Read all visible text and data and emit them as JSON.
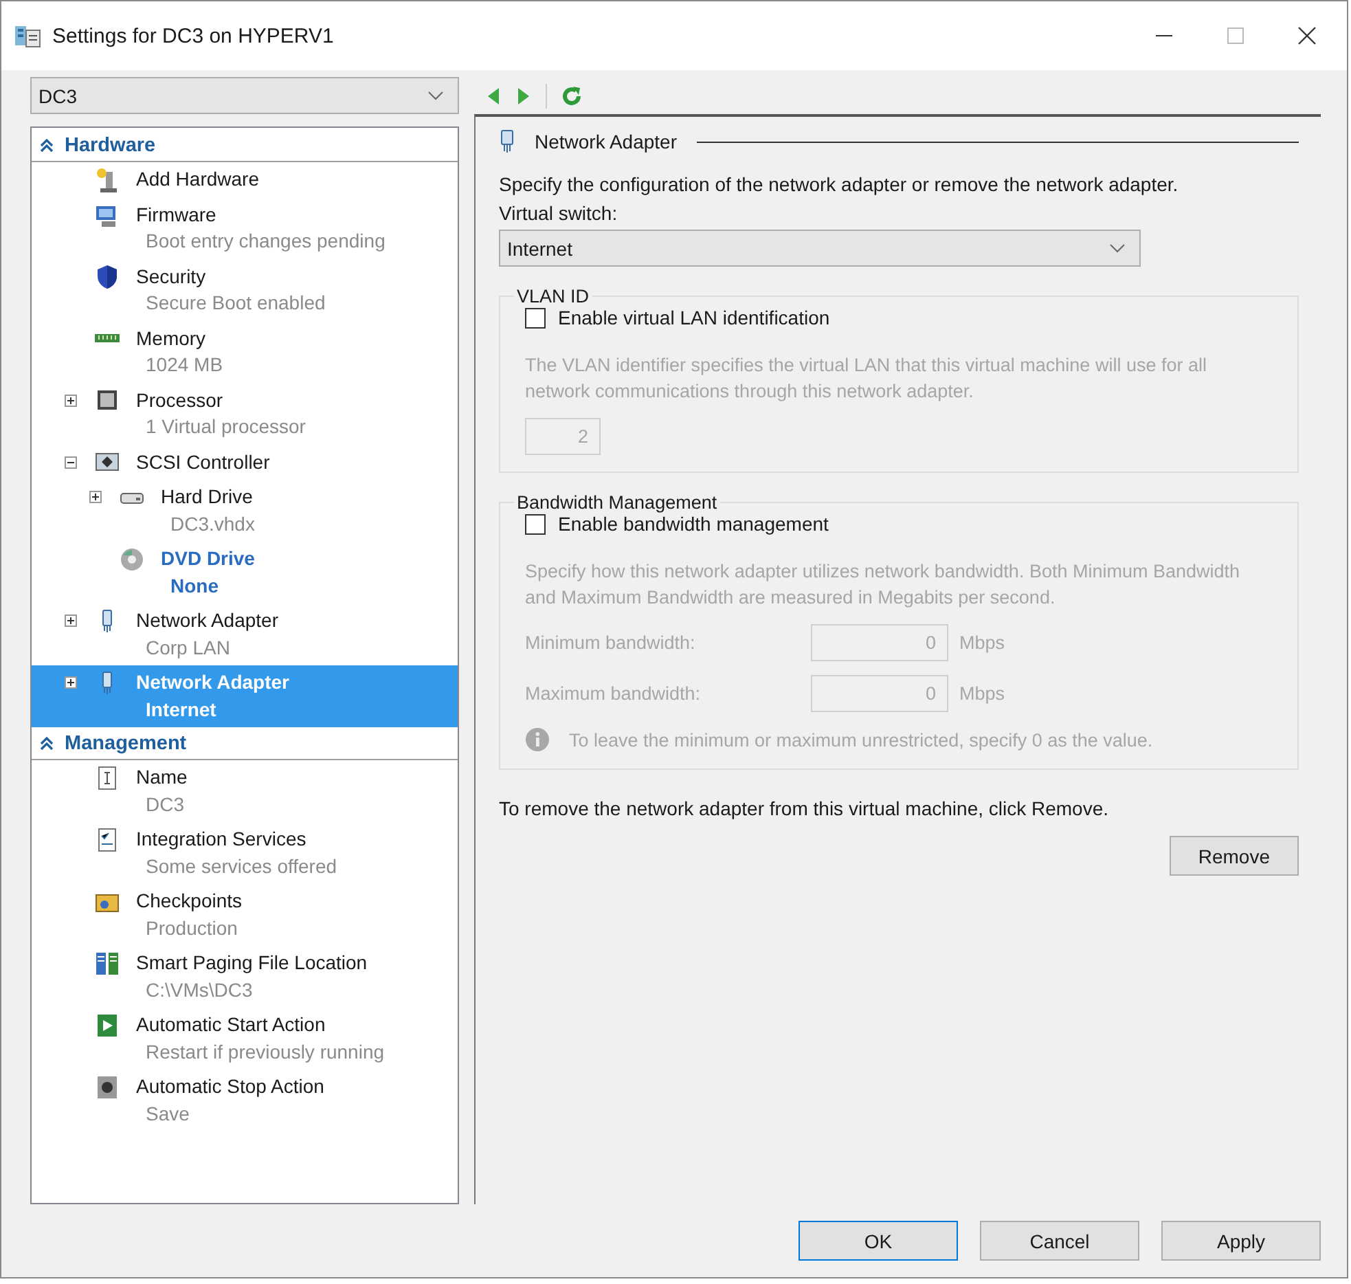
{
  "window": {
    "title": "Settings for DC3 on HYPERV1"
  },
  "vm_selector": {
    "value": "DC3"
  },
  "tree": [
    {
      "label": "Hardware",
      "kind": "section",
      "expanded": true,
      "children": [
        {
          "label": "Add Hardware",
          "selected": false
        },
        {
          "label": "Firmware",
          "detail": "Boot entry changes pending",
          "selected": false
        },
        {
          "label": "Security",
          "detail": "Secure Boot enabled",
          "selected": false
        },
        {
          "label": "Memory",
          "detail": "1024 MB",
          "selected": false
        },
        {
          "label": "Processor",
          "detail": "1 Virtual processor",
          "expanded": false,
          "selected": false
        },
        {
          "label": "SCSI Controller",
          "expanded": true,
          "selected": false,
          "children": [
            {
              "label": "Hard Drive",
              "detail": "DC3.vhdx",
              "expanded": false,
              "selected": false
            },
            {
              "label": "DVD Drive",
              "detail": "None",
              "emphasized": true,
              "selected": false
            }
          ]
        },
        {
          "label": "Network Adapter",
          "detail": "Corp LAN",
          "expanded": false,
          "selected": false
        },
        {
          "label": "Network Adapter",
          "detail": "Internet",
          "expanded": false,
          "selected": true
        }
      ]
    },
    {
      "label": "Management",
      "kind": "section",
      "expanded": true,
      "children": [
        {
          "label": "Name",
          "detail": "DC3",
          "selected": false
        },
        {
          "label": "Integration Services",
          "detail": "Some services offered",
          "selected": false
        },
        {
          "label": "Checkpoints",
          "detail": "Production",
          "selected": false
        },
        {
          "label": "Smart Paging File Location",
          "detail": "C:\\VMs\\DC3",
          "selected": false
        },
        {
          "label": "Automatic Start Action",
          "detail": "Restart if previously running",
          "selected": false
        },
        {
          "label": "Automatic Stop Action",
          "detail": "Save",
          "selected": false
        }
      ]
    }
  ],
  "details": {
    "heading": "Network Adapter",
    "description": "Specify the configuration of the network adapter or remove the network adapter.",
    "switch_label": "Virtual switch:",
    "switch_value": "Internet",
    "groups": [
      {
        "legend": "VLAN ID",
        "checkbox": {
          "label": "Enable virtual LAN identification",
          "checked": false
        },
        "disabled": true,
        "note": "The VLAN identifier specifies the virtual LAN that this virtual machine will use for all network communications through this network adapter.",
        "fields": [
          {
            "value": "2"
          }
        ]
      },
      {
        "legend": "Bandwidth Management",
        "checkbox": {
          "label": "Enable bandwidth management",
          "checked": false
        },
        "disabled": true,
        "note": "Specify how this network adapter utilizes network bandwidth. Both Minimum Bandwidth and Maximum Bandwidth are measured in Megabits per second.",
        "fields": [
          {
            "label": "Minimum bandwidth:",
            "value": "0",
            "unit": "Mbps"
          },
          {
            "label": "Maximum bandwidth:",
            "value": "0",
            "unit": "Mbps"
          }
        ],
        "info": "To leave the minimum or maximum unrestricted, specify 0 as the value."
      }
    ],
    "remove_text": "To remove the network adapter from this virtual machine, click Remove.",
    "remove_button": "Remove"
  },
  "buttons": [
    {
      "label": "OK",
      "default": true
    },
    {
      "label": "Cancel",
      "default": false
    },
    {
      "label": "Apply",
      "default": false
    }
  ]
}
